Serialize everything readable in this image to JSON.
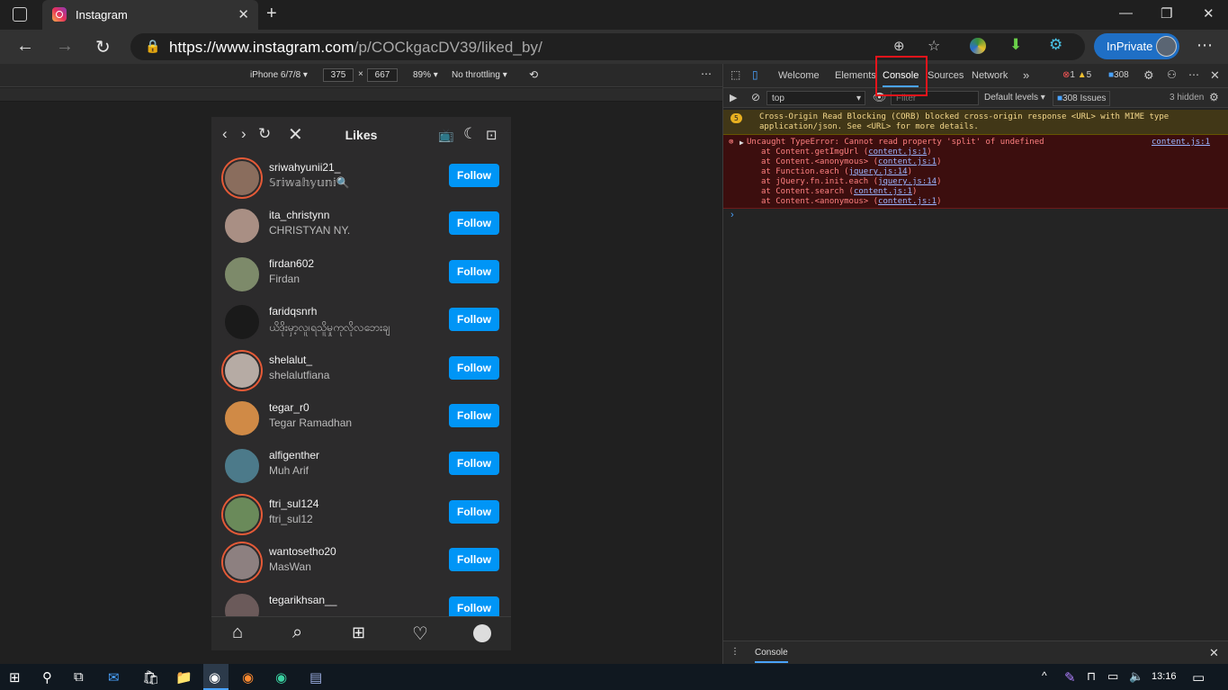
{
  "browser": {
    "tab_title": "Instagram",
    "url_host": "https://www.instagram.com",
    "url_path": "/p/COCkgacDV39/liked_by/",
    "inprivate": "InPrivate"
  },
  "device_toolbar": {
    "device": "iPhone 6/7/8 ▾",
    "width": "375",
    "times": "×",
    "height": "667",
    "zoom": "89% ▾",
    "throttle": "No throttling ▾"
  },
  "phone": {
    "title": "Likes",
    "follow_label": "Follow",
    "users": [
      {
        "username": "sriwahyunii21_",
        "name": "𝕊𝕣𝕚𝕨𝕒𝕙𝕪𝕦𝕟𝕚🔍",
        "ring": true,
        "color": "#8a6d5d"
      },
      {
        "username": "ita_christynn",
        "name": "CHRISTYAN NY.",
        "ring": false,
        "color": "#a98f84"
      },
      {
        "username": "firdan602",
        "name": "Firdan",
        "ring": false,
        "color": "#7d8a6a"
      },
      {
        "username": "faridqsnrh",
        "name": "ယိဒိုးမှာ့လူ၊ရသိူမှုကုလိုလဘေးချ",
        "ring": false,
        "color": "#1a1a1a"
      },
      {
        "username": "shelalut_",
        "name": "shelalutfiana",
        "ring": true,
        "color": "#b6aba4"
      },
      {
        "username": "tegar_r0",
        "name": "Tegar Ramadhan",
        "ring": false,
        "color": "#d08a46"
      },
      {
        "username": "alfigenther",
        "name": "Muh Arif",
        "ring": false,
        "color": "#4c7a8a"
      },
      {
        "username": "ftri_sul124",
        "name": "ftri_sul12",
        "ring": true,
        "color": "#6a8a5a"
      },
      {
        "username": "wantosetho20",
        "name": "MasWan",
        "ring": true,
        "color": "#8d8080"
      },
      {
        "username": "tegarikhsan__",
        "name": "",
        "ring": false,
        "color": "#6b5a5a"
      }
    ]
  },
  "devtools": {
    "tabs": [
      "Welcome",
      "Elements",
      "Console",
      "Sources",
      "Network"
    ],
    "active_tab": "Console",
    "errors": "1",
    "warnings": "5",
    "issues_count": "308",
    "context": "top",
    "filter_placeholder": "Filter",
    "levels": "Default levels ▾",
    "issues": "308 Issues",
    "hidden": "3 hidden",
    "warn_count": "5",
    "warn_text_1": "Cross-Origin Read Blocking (CORB) blocked cross-origin response <URL> with MIME type",
    "warn_text_2": "application/json. See <URL> for more details.",
    "error_text": "Uncaught TypeError: Cannot read property 'split' of undefined",
    "error_link": "content.js:1",
    "stack": [
      [
        "at Content.getImgUrl (",
        "content.js:1",
        ")"
      ],
      [
        "at Content.<anonymous> (",
        "content.js:1",
        ")"
      ],
      [
        "at Function.each (",
        "jquery.js:14",
        ")"
      ],
      [
        "at jQuery.fn.init.each (",
        "jquery.js:14",
        ")"
      ],
      [
        "at Content.search (",
        "content.js:1",
        ")"
      ],
      [
        "at Content.<anonymous> (",
        "content.js:1",
        ")"
      ]
    ],
    "drawer_tab": "Console"
  },
  "taskbar": {
    "time": "13:16"
  }
}
